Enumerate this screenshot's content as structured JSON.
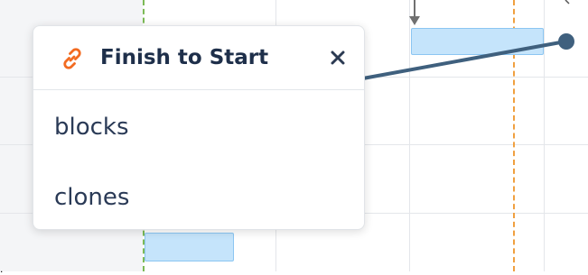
{
  "popup": {
    "title": "Finish to Start",
    "icon": "link-icon",
    "close_icon": "close-icon",
    "items": [
      {
        "label": "blocks"
      },
      {
        "label": "clones"
      }
    ]
  },
  "colors": {
    "accent_orange": "#f26b21",
    "title_text": "#1e2f4a",
    "task_bar_fill": "#c5e4fb",
    "dependency_line": "#3f607e",
    "today_green": "#7cba56",
    "marker_orange": "#f0a040"
  }
}
